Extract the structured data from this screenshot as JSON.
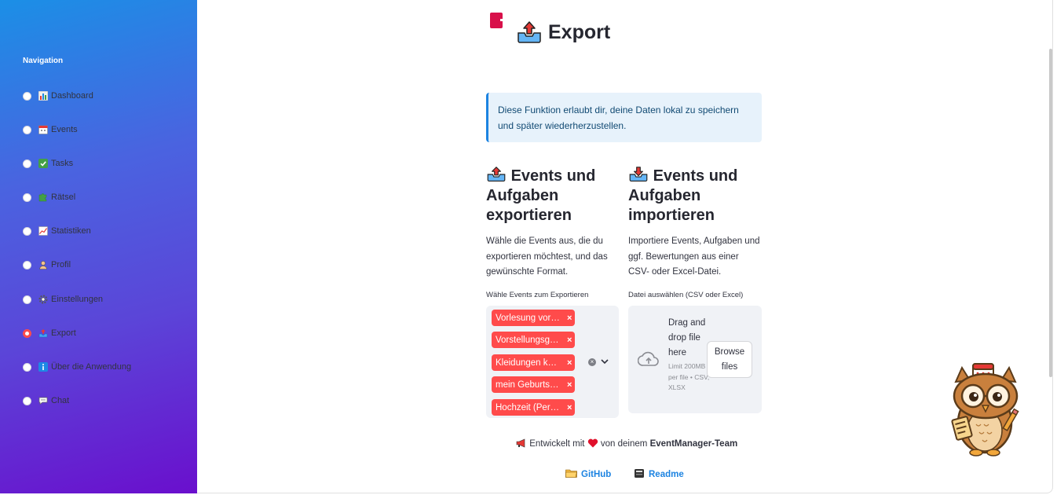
{
  "sidebar": {
    "title": "Navigation",
    "items": [
      {
        "label": "Dashboard",
        "icon": "bar-chart-icon",
        "selected": false
      },
      {
        "label": "Events",
        "icon": "calendar-icon",
        "selected": false
      },
      {
        "label": "Tasks",
        "icon": "checkmark-icon",
        "selected": false
      },
      {
        "label": "Rätsel",
        "icon": "puzzle-icon",
        "selected": false
      },
      {
        "label": "Statistiken",
        "icon": "trend-chart-icon",
        "selected": false
      },
      {
        "label": "Profil",
        "icon": "person-icon",
        "selected": false
      },
      {
        "label": "Einstellungen",
        "icon": "gear-icon",
        "selected": false
      },
      {
        "label": "Export",
        "icon": "outbox-tray-icon",
        "selected": true
      },
      {
        "label": "Über die Anwendung",
        "icon": "info-icon",
        "selected": false
      },
      {
        "label": "Chat",
        "icon": "speech-bubble-icon",
        "selected": false
      }
    ]
  },
  "main": {
    "title": "Export",
    "info": "Diese Funktion erlaubt dir, deine Daten lokal zu speichern und später wiederherzustellen.",
    "export": {
      "heading": "Events und Aufgaben exportieren",
      "description": "Wähle die Events aus, die du exportieren möchtest, und das gewünschte Format.",
      "select_label": "Wähle Events zum Exportieren",
      "selected_events": [
        "Vorlesung vor…",
        "Vorstellungsg…",
        "Kleidungen k…",
        "mein Geburts…",
        "Hochzeit (Per…"
      ],
      "remove_symbol": "×"
    },
    "import": {
      "heading": "Events und Aufgaben importieren",
      "description": "Importiere Events, Aufgaben und ggf. Bewertungen aus einer CSV- oder Excel-Datei.",
      "file_label": "Datei auswählen (CSV oder Excel)",
      "dropzone_text": "Drag and drop file here",
      "limit_text": "Limit 200MB per file • CSV, XLSX",
      "browse_label": "Browse files"
    },
    "footer": {
      "prefix": "Entwickelt mit",
      "middle": "von deinem",
      "team": "EventManager-Team",
      "github": "GitHub",
      "readme": "Readme"
    }
  },
  "colors": {
    "accent": "#ff4b4b",
    "link": "#1c83e1",
    "info_bg": "#e7f2fb",
    "sidebar_top": "#1b8fe6",
    "sidebar_bottom": "#6a0fcd"
  }
}
